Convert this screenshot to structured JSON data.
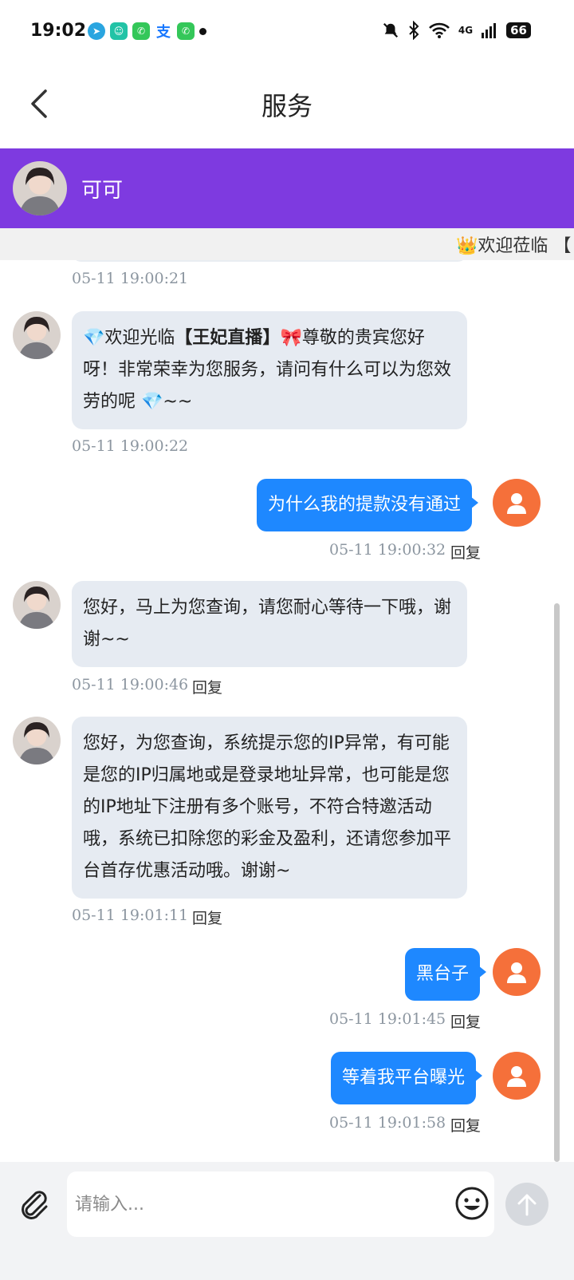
{
  "status_bar": {
    "time": "19:02",
    "network": "4G",
    "battery": "66"
  },
  "header": {
    "title": "服务"
  },
  "agent": {
    "name": "可可"
  },
  "notice": {
    "text": "👑欢迎莅临 【"
  },
  "messages": [
    {
      "from": "agent",
      "parts": {
        "gem1": "💎",
        "pre": "欢迎光临",
        "bold": "【王妃直播】",
        "bow": "🎀",
        "post": "尊敬的贵宾您好呀！非常荣幸为您服务，请问有什么可以为您效劳的呢 ",
        "gem2": "💎",
        "tail": "~~"
      },
      "time": "05-11 19:00:22"
    },
    {
      "from": "user",
      "text": "为什么我的提款没有通过",
      "time": "05-11 19:00:32",
      "reply": "回复"
    },
    {
      "from": "agent",
      "text": "您好，马上为您查询，请您耐心等待一下哦，谢谢~~",
      "time": "05-11 19:00:46",
      "reply": "回复"
    },
    {
      "from": "agent",
      "text": "您好，为您查询，系统提示您的IP异常，有可能是您的IP归属地或是登录地址异常，也可能是您的IP地址下注册有多个账号，不符合特邀活动哦，系统已扣除您的彩金及盈利，还请您参加平台首存优惠活动哦。谢谢~",
      "time": "05-11 19:01:11",
      "reply": "回复"
    },
    {
      "from": "user",
      "text": "黑台子",
      "time": "05-11 19:01:45",
      "reply": "回复"
    },
    {
      "from": "user",
      "text": "等着我平台曝光",
      "time": "05-11 19:01:58",
      "reply": "回复"
    }
  ],
  "earlier_time": "05-11 19:00:21",
  "input": {
    "placeholder": "请输入..."
  },
  "colors": {
    "agent_bar": "#7e3ae0",
    "user_bubble": "#1e88ff",
    "agent_bubble": "#e6ebf2",
    "user_avatar": "#f5703a"
  }
}
